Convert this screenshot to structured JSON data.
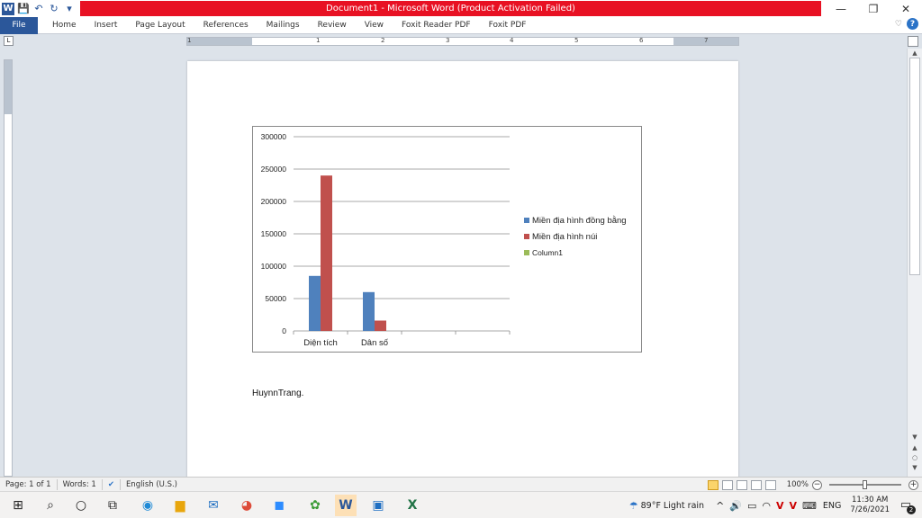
{
  "window": {
    "title": "Document1  -  Microsoft Word (Product Activation Failed)",
    "minimize": "—",
    "restore": "❐",
    "close": "✕"
  },
  "qat": {
    "save": "💾",
    "undo": "↶",
    "redo": "↻",
    "more": "▾"
  },
  "ribbon": {
    "tabs": [
      "File",
      "Home",
      "Insert",
      "Page Layout",
      "References",
      "Mailings",
      "Review",
      "View",
      "Foxit Reader PDF",
      "Foxit PDF"
    ],
    "collapse": "♡",
    "help": "?"
  },
  "ruler": {
    "corner": "L",
    "numbers": [
      "1",
      "1",
      "2",
      "3",
      "4",
      "5",
      "6",
      "7"
    ]
  },
  "document": {
    "signature": "HuynnTrang."
  },
  "chart_data": {
    "type": "bar",
    "categories": [
      "Diện tích",
      "Dân số",
      "",
      ""
    ],
    "series": [
      {
        "name": "Miền địa hình  đồng bằng",
        "color": "#4f81bd",
        "values": [
          85000,
          60000,
          null,
          null
        ]
      },
      {
        "name": "Miền  địa hình  núi",
        "color": "#c0504d",
        "values": [
          240000,
          16000,
          null,
          null
        ]
      },
      {
        "name": "Column1",
        "color": "#9bbb59",
        "values": [
          null,
          null,
          null,
          null
        ]
      }
    ],
    "ylim": [
      0,
      300000
    ],
    "yticks": [
      "0",
      "50000",
      "100000",
      "150000",
      "200000",
      "250000",
      "300000"
    ],
    "grid": true,
    "legend": "right"
  },
  "status": {
    "page": "Page: 1 of 1",
    "words": "Words: 1",
    "language": "English (U.S.)",
    "zoom": "100%",
    "zoom_fraction": 0.5
  },
  "taskbar": {
    "weather": "89°F  Light rain",
    "lang": "ENG",
    "time": "11:30 AM",
    "date": "7/26/2021",
    "notifications": "2"
  }
}
